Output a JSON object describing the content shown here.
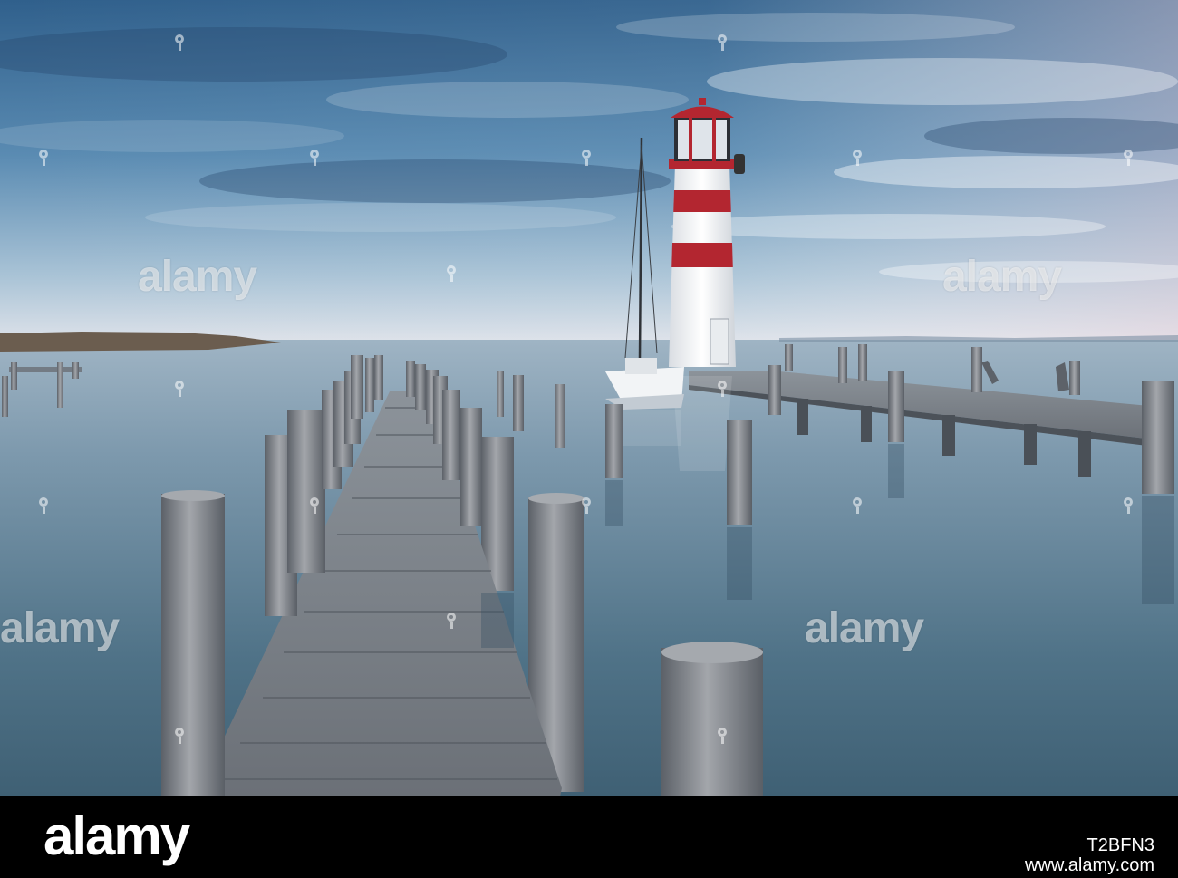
{
  "watermark": {
    "text": "alamy"
  },
  "footer": {
    "logo": "alamy",
    "image_id": "T2BFN3",
    "url": "www.alamy.com"
  },
  "colors": {
    "sky_top": "#3c6f99",
    "sky_bottom": "#d4e0ea",
    "water": "#5a7d94",
    "lighthouse_white": "#f4f4f2",
    "lighthouse_red": "#b32630",
    "wood": "#7a8088",
    "footer_bg": "#000000",
    "footer_text": "#ffffff"
  }
}
